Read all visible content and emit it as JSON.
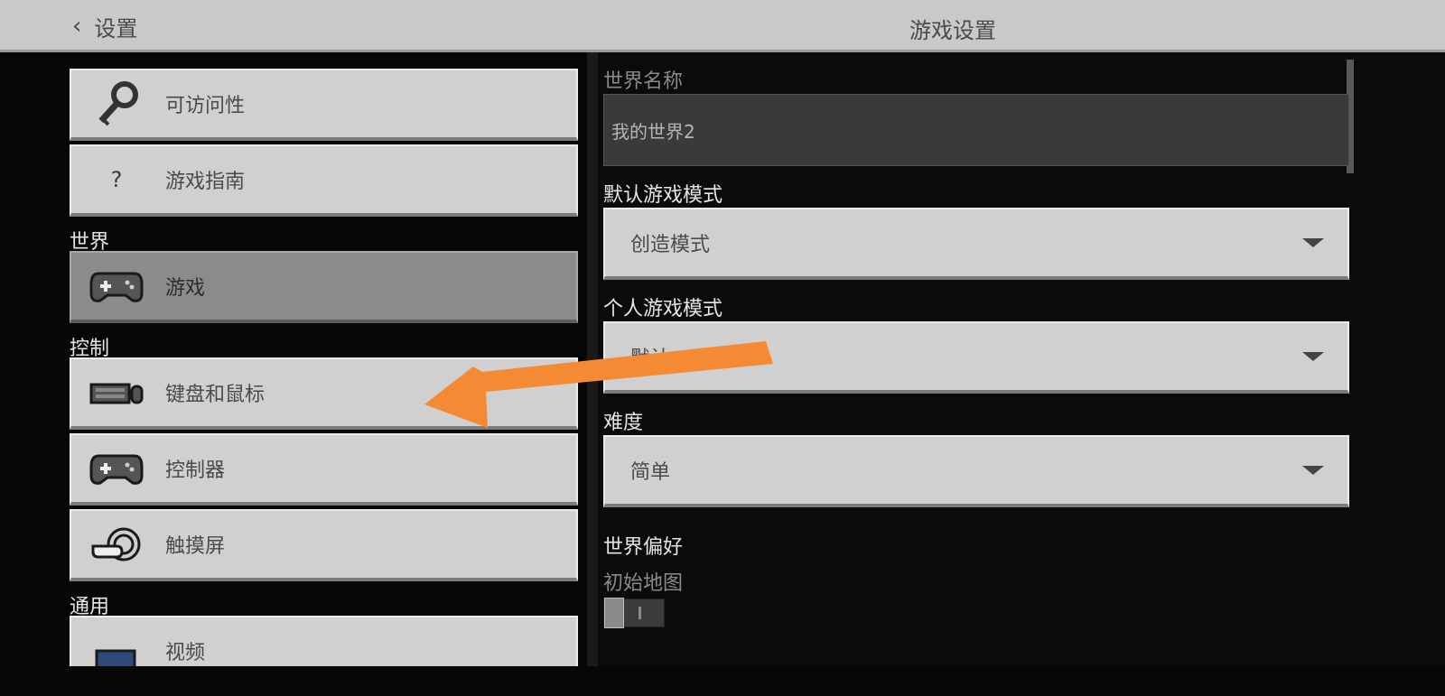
{
  "header": {
    "back_label": "设置",
    "title": "游戏设置"
  },
  "sidebar": {
    "items_top": [
      {
        "label": "可访问性",
        "icon": "key-icon"
      },
      {
        "label": "游戏指南",
        "icon": "question-icon",
        "icon_glyph": "?"
      }
    ],
    "section_world": "世界",
    "world_items": [
      {
        "label": "游戏",
        "icon": "gamepad-icon",
        "active": true
      }
    ],
    "section_controls": "控制",
    "control_items": [
      {
        "label": "键盘和鼠标",
        "icon": "keyboard-mouse-icon"
      },
      {
        "label": "控制器",
        "icon": "gamepad-icon"
      },
      {
        "label": "触摸屏",
        "icon": "touch-icon"
      }
    ],
    "section_general": "通用",
    "general_items": [
      {
        "label": "视频",
        "icon": "monitor-icon"
      }
    ]
  },
  "settings": {
    "world_name_label": "世界名称",
    "world_name_value": "我的世界2",
    "default_mode_label": "默认游戏模式",
    "default_mode_value": "创造模式",
    "personal_mode_label": "个人游戏模式",
    "personal_mode_value": "默认",
    "difficulty_label": "难度",
    "difficulty_value": "简单",
    "world_prefs_label": "世界偏好",
    "starting_map_label": "初始地图",
    "starting_map_enabled": false
  },
  "colors": {
    "annotation_arrow": "#f58a34",
    "button_bg": "#d0d0d0",
    "active_button_bg": "#8b8b8b",
    "background": "#0b0b0b"
  }
}
